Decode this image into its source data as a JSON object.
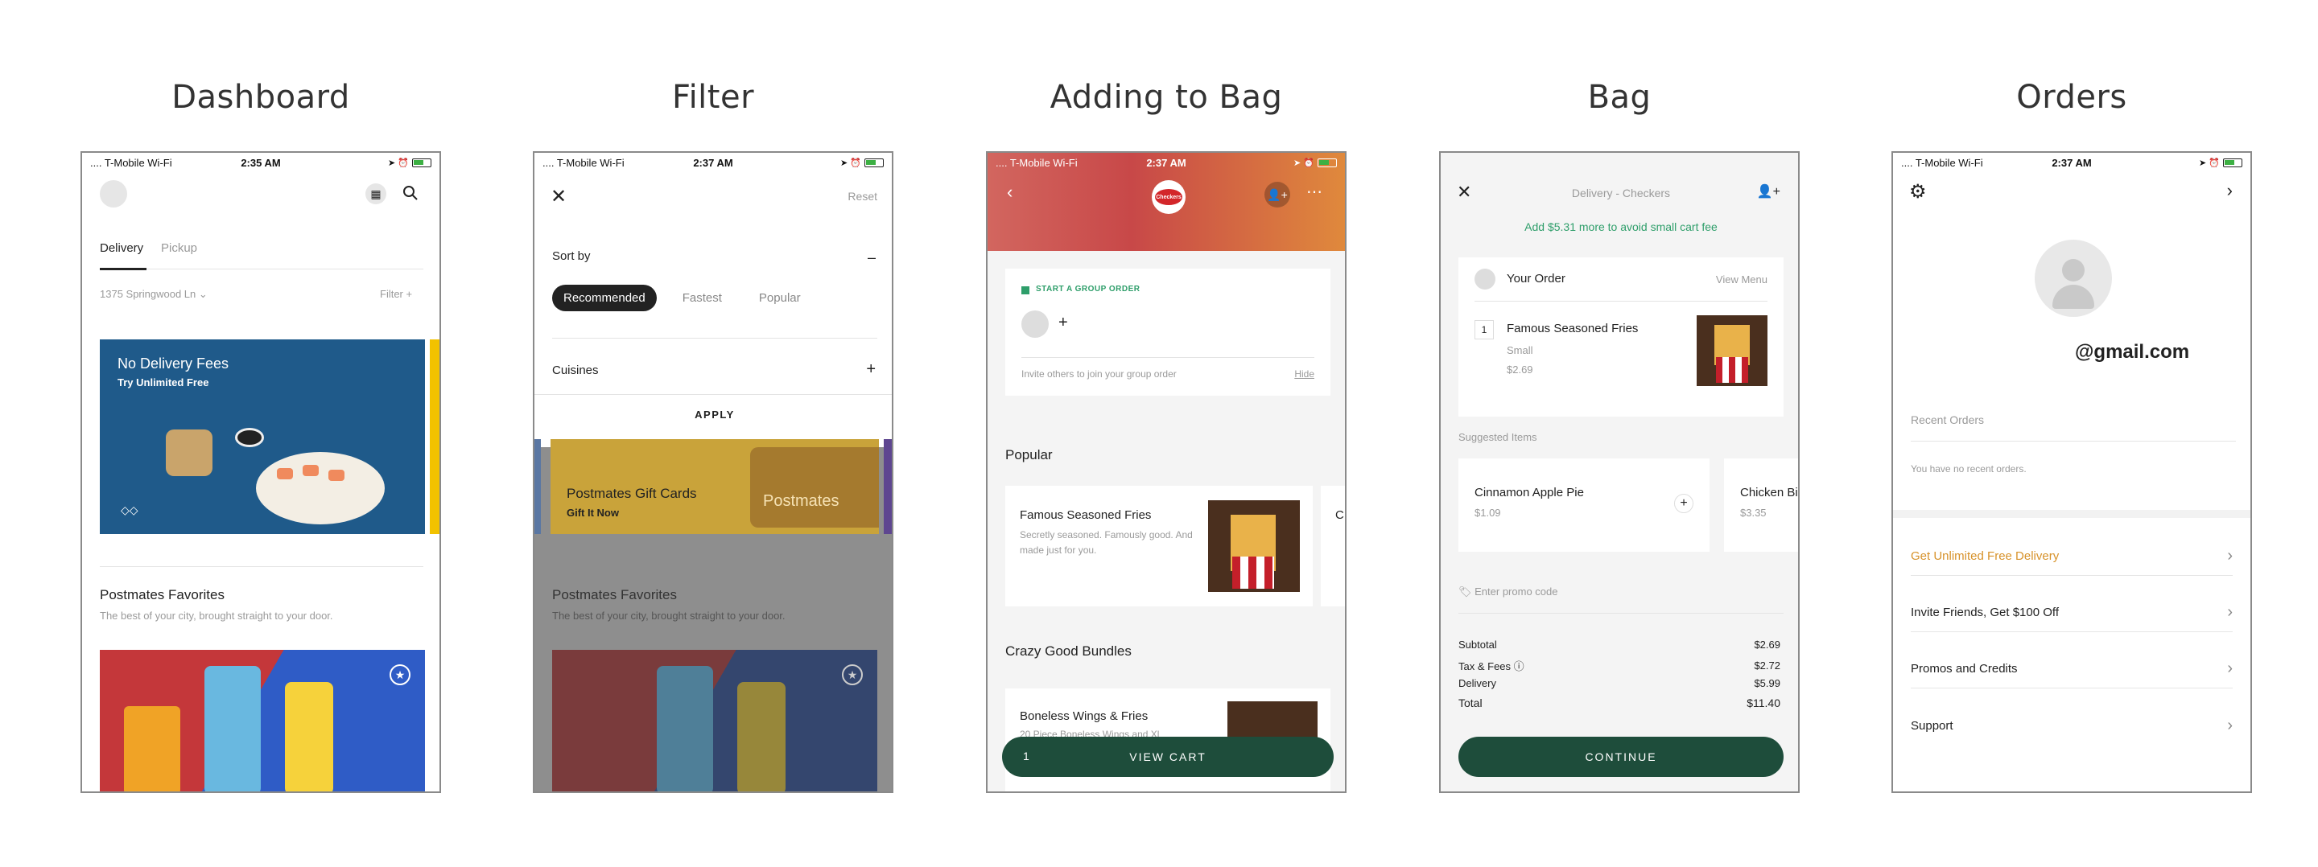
{
  "columns": {
    "dashboard": "Dashboard",
    "filter": "Filter",
    "adding": "Adding to Bag",
    "bag": "Bag",
    "orders": "Orders"
  },
  "status": {
    "carrier": ".... T-Mobile Wi-Fi",
    "time_dashboard": "2:35 AM",
    "time_filter": "2:37 AM",
    "time_adding": "2:37 AM",
    "time_orders": "2:37 AM"
  },
  "dashboard": {
    "tabs": [
      "Delivery",
      "Pickup"
    ],
    "address": "1375 Springwood Ln",
    "filter": "Filter",
    "promo_title": "No Delivery Fees",
    "promo_sub": "Try Unlimited Free",
    "section_title": "Postmates Favorites",
    "section_sub": "The best of your city, brought straight to your door."
  },
  "filter": {
    "reset": "Reset",
    "sort_by": "Sort by",
    "sort_options": [
      "Recommended",
      "Fastest",
      "Popular"
    ],
    "cuisines": "Cuisines",
    "apply": "APPLY",
    "gift_title": "Postmates Gift Cards",
    "gift_sub": "Gift It Now",
    "gift_brand": "Postmates",
    "section_title": "Postmates Favorites",
    "section_sub": "The best of your city, brought straight to your door."
  },
  "adding": {
    "logo": "Checkers",
    "group_order": "START A GROUP ORDER",
    "invite": "Invite others to join your group order",
    "hide": "Hide",
    "popular": "Popular",
    "item1_name": "Famous Seasoned Fries",
    "item1_desc": "Secretly seasoned. Famously good. And made just for you.",
    "item2_cut": "C",
    "bundles": "Crazy Good Bundles",
    "item3_name": "Boneless Wings & Fries",
    "item3_desc": "20 Piece Boneless Wings and Xl",
    "cart_count": "1",
    "view_cart": "VIEW CART"
  },
  "bag": {
    "title": "Delivery - Checkers",
    "small_fee": "Add $5.31 more to avoid small cart fee",
    "your_order": "Your Order",
    "view_menu": "View Menu",
    "qty": "1",
    "item_name": "Famous Seasoned Fries",
    "item_size": "Small",
    "item_price": "$2.69",
    "suggested": "Suggested Items",
    "sugg1_name": "Cinnamon Apple Pie",
    "sugg1_price": "$1.09",
    "sugg2_name": "Chicken Bi",
    "sugg2_price": "$3.35",
    "promo": "Enter promo code",
    "subtotal_label": "Subtotal",
    "subtotal": "$2.69",
    "tax_label": "Tax & Fees",
    "tax": "$2.72",
    "delivery_label": "Delivery",
    "delivery": "$5.99",
    "total_label": "Total",
    "total": "$11.40",
    "continue": "CONTINUE"
  },
  "orders": {
    "email": "@gmail.com",
    "recent": "Recent Orders",
    "no_recent": "You have no recent orders.",
    "menu": [
      "Get Unlimited Free Delivery",
      "Invite Friends, Get $100 Off",
      "Promos and Credits",
      "Support"
    ]
  },
  "colors": {
    "accent_green": "#1e4d3b",
    "fee_green": "#2e9e6a",
    "unlimited_orange": "#d7922a"
  }
}
